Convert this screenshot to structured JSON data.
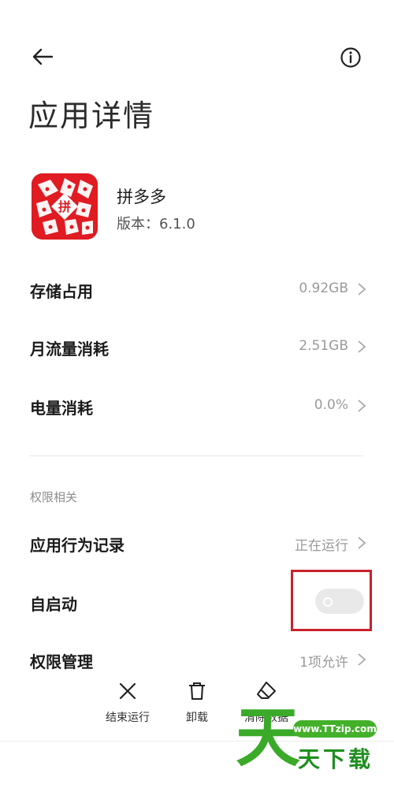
{
  "header": {
    "title": "应用详情",
    "back_icon": "arrow-left-icon",
    "info_icon": "info-circle-icon"
  },
  "app": {
    "name": "拼多多",
    "version": "版本：6.1.0",
    "icon_color": "#e01b22",
    "icon_glyph": "拼"
  },
  "stats": [
    {
      "label": "存储占用",
      "value": "0.92GB"
    },
    {
      "label": "月流量消耗",
      "value": "2.51GB"
    },
    {
      "label": "电量消耗",
      "value": "0.0%"
    }
  ],
  "permissions": {
    "section_title": "权限相关",
    "behavior": {
      "label": "应用行为记录",
      "value": "正在运行"
    },
    "autostart": {
      "label": "自启动",
      "enabled": false
    },
    "management": {
      "label": "权限管理",
      "value": "1项允许"
    }
  },
  "actions": [
    {
      "label": "结束运行",
      "icon": "close-x-icon"
    },
    {
      "label": "卸载",
      "icon": "trash-icon"
    },
    {
      "label": "清除数据",
      "icon": "eraser-icon"
    }
  ],
  "watermark": {
    "url": "www.TTzip.com",
    "text": "天下载",
    "big_char": "天"
  },
  "colors": {
    "accent_highlight": "#c8222a",
    "secondary_text": "#9a9a9a",
    "watermark_green": "#43b02a"
  }
}
